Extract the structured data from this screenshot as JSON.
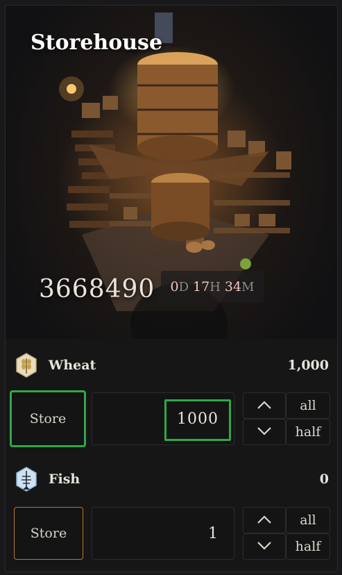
{
  "storehouse": {
    "title": "Storehouse",
    "count": "3668490",
    "timer": {
      "days": "0",
      "days_unit": "D",
      "hours": "17",
      "hours_unit": "H",
      "minutes": "34",
      "minutes_unit": "M"
    }
  },
  "resources": [
    {
      "name": "Wheat",
      "amount": "1,000",
      "icon": "wheat-icon",
      "store_label": "Store",
      "quantity": "1000",
      "all_label": "all",
      "half_label": "half"
    },
    {
      "name": "Fish",
      "amount": "0",
      "icon": "fish-icon",
      "store_label": "Store",
      "quantity": "1",
      "all_label": "all",
      "half_label": "half"
    }
  ],
  "colors": {
    "highlight": "#2fa84a",
    "accent_orange": "#b9772c",
    "background": "#161617"
  }
}
